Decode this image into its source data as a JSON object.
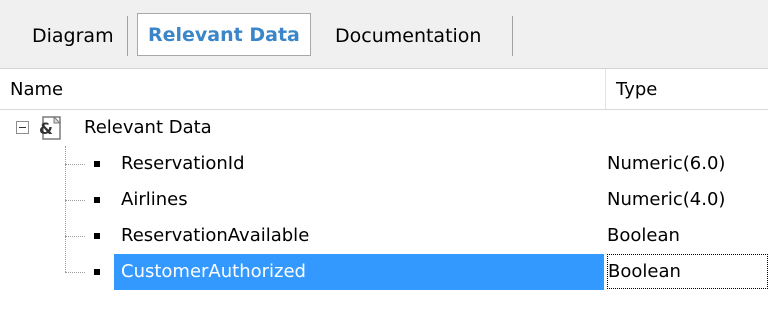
{
  "tabs": [
    {
      "label": "Diagram",
      "active": false
    },
    {
      "label": "Relevant Data",
      "active": true
    },
    {
      "label": "Documentation",
      "active": false
    }
  ],
  "columns": {
    "name": "Name",
    "type": "Type"
  },
  "tree": {
    "root": {
      "label": "Relevant Data",
      "icon": "ampersand-document-icon",
      "expanded": true
    },
    "items": [
      {
        "name": "ReservationId",
        "type": "Numeric(6.0)",
        "selected": false
      },
      {
        "name": "Airlines",
        "type": "Numeric(4.0)",
        "selected": false
      },
      {
        "name": "ReservationAvailable",
        "type": "Boolean",
        "selected": false
      },
      {
        "name": "CustomerAuthorized",
        "type": "Boolean",
        "selected": true
      }
    ]
  },
  "colors": {
    "accent_tab": "#3a86c8",
    "selection": "#3399ff"
  }
}
